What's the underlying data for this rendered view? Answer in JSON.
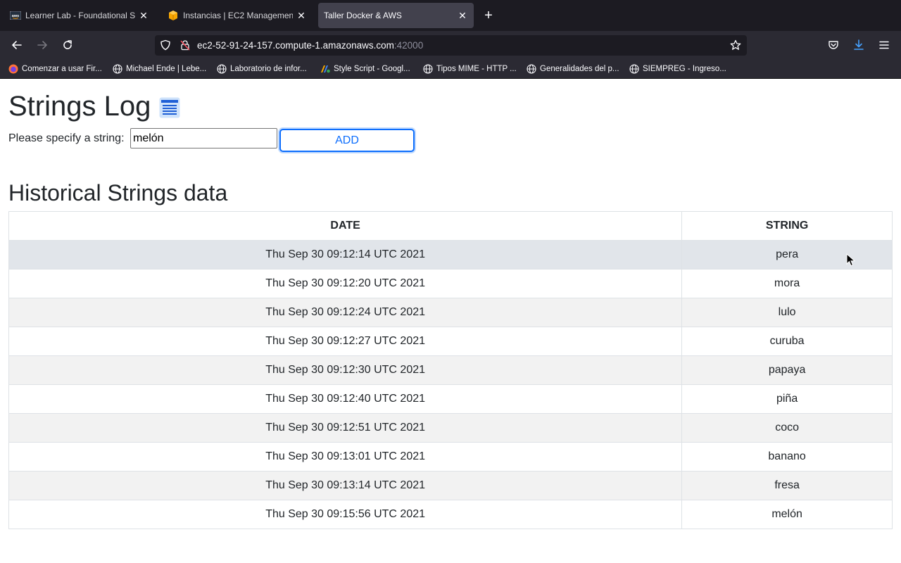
{
  "browser": {
    "tabs": [
      {
        "title": "Learner Lab - Foundational Serv",
        "active": false
      },
      {
        "title": "Instancias | EC2 Management C",
        "active": false
      },
      {
        "title": "Taller Docker & AWS",
        "active": true
      }
    ],
    "url_host": "ec2-52-91-24-157.compute-1.amazonaws.com",
    "url_port": ":42000",
    "bookmarks": [
      "Comenzar a usar Fir...",
      "Michael Ende | Lebe...",
      "Laboratorio de infor...",
      "Style Script - Googl...",
      "Tipos MIME - HTTP ...",
      "Generalidades del p...",
      "SIEMPREG - Ingreso..."
    ]
  },
  "page": {
    "title": "Strings Log",
    "input_label": "Please specify a string:",
    "input_value": "melón",
    "add_label": "ADD",
    "section_title": "Historical Strings data",
    "table": {
      "headers": [
        "DATE",
        "STRING"
      ],
      "rows": [
        [
          "Thu Sep 30 09:12:14 UTC 2021",
          "pera"
        ],
        [
          "Thu Sep 30 09:12:20 UTC 2021",
          "mora"
        ],
        [
          "Thu Sep 30 09:12:24 UTC 2021",
          "lulo"
        ],
        [
          "Thu Sep 30 09:12:27 UTC 2021",
          "curuba"
        ],
        [
          "Thu Sep 30 09:12:30 UTC 2021",
          "papaya"
        ],
        [
          "Thu Sep 30 09:12:40 UTC 2021",
          "piña"
        ],
        [
          "Thu Sep 30 09:12:51 UTC 2021",
          "coco"
        ],
        [
          "Thu Sep 30 09:13:01 UTC 2021",
          "banano"
        ],
        [
          "Thu Sep 30 09:13:14 UTC 2021",
          "fresa"
        ],
        [
          "Thu Sep 30 09:15:56 UTC 2021",
          "melón"
        ]
      ]
    }
  },
  "colors": {
    "accent": "#0d6efd",
    "chrome_dark": "#1c1b22",
    "chrome_toolbar": "#2b2a33",
    "row_stripe": "#f2f2f2",
    "row_hover": "#e1e5ea"
  }
}
